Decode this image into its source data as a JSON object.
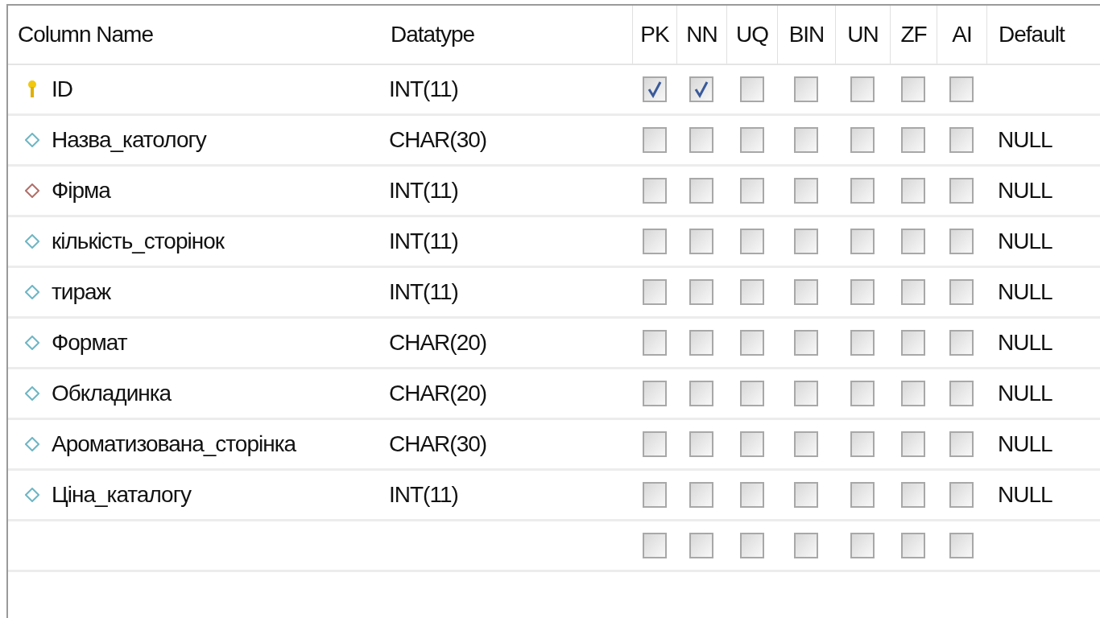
{
  "columns": [
    "Column Name",
    "Datatype",
    "PK",
    "NN",
    "UQ",
    "BIN",
    "UN",
    "ZF",
    "AI",
    "Default"
  ],
  "rows": [
    {
      "kind": "pk",
      "name": "ID",
      "datatype": "INT(11)",
      "checks": [
        true,
        true,
        false,
        false,
        false,
        false,
        false
      ]
    },
    {
      "kind": "column",
      "name": "Назва_катологу",
      "datatype": "CHAR(30)",
      "checks": [
        false,
        false,
        false,
        false,
        false,
        false,
        false
      ],
      "default": "NULL"
    },
    {
      "kind": "fk",
      "name": "Фірма",
      "datatype": "INT(11)",
      "checks": [
        false,
        false,
        false,
        false,
        false,
        false,
        false
      ],
      "default": "NULL"
    },
    {
      "kind": "column",
      "name": "кількість_сторінок",
      "datatype": "INT(11)",
      "checks": [
        false,
        false,
        false,
        false,
        false,
        false,
        false
      ],
      "default": "NULL"
    },
    {
      "kind": "column",
      "name": "тираж",
      "datatype": "INT(11)",
      "checks": [
        false,
        false,
        false,
        false,
        false,
        false,
        false
      ],
      "default": "NULL"
    },
    {
      "kind": "column",
      "name": "Формат",
      "datatype": "CHAR(20)",
      "checks": [
        false,
        false,
        false,
        false,
        false,
        false,
        false
      ],
      "default": "NULL"
    },
    {
      "kind": "column",
      "name": "Обкладинка",
      "datatype": "CHAR(20)",
      "checks": [
        false,
        false,
        false,
        false,
        false,
        false,
        false
      ],
      "default": "NULL"
    },
    {
      "kind": "column",
      "name": "Ароматизована_сторінка",
      "datatype": "CHAR(30)",
      "checks": [
        false,
        false,
        false,
        false,
        false,
        false,
        false
      ],
      "default": "NULL"
    },
    {
      "kind": "column",
      "name": "Ціна_каталогу",
      "datatype": "INT(11)",
      "checks": [
        false,
        false,
        false,
        false,
        false,
        false,
        false
      ],
      "default": "NULL"
    },
    {
      "kind": "new",
      "checks": [
        false,
        false,
        false,
        false,
        false,
        false,
        false
      ]
    }
  ]
}
